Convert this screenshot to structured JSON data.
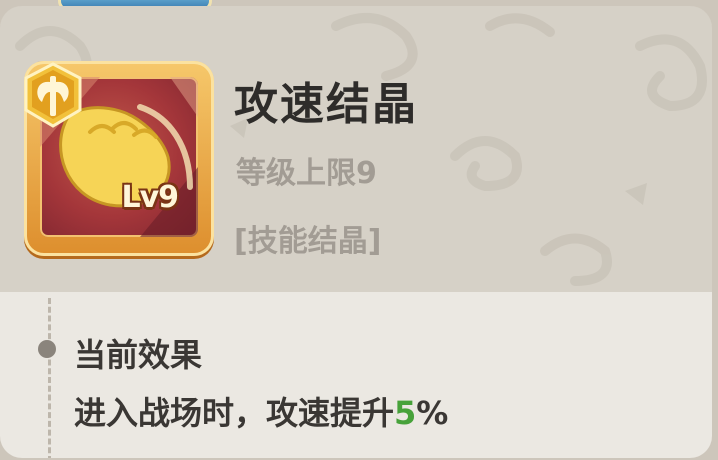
{
  "item": {
    "name": "攻速结晶",
    "level_cap_text": "等级上限9",
    "category": "[技能结晶]",
    "level_badge": "Lv9",
    "icon": "fist-crystal-icon",
    "badge_icon": "axe-emblem-icon"
  },
  "effect": {
    "header": "当前效果",
    "text_prefix": "进入战场时，攻速提升",
    "value": "5",
    "unit": "%"
  },
  "colors": {
    "highlight_value": "#47a23a",
    "title_text": "#2e2c2a",
    "muted_text": "#a29c94"
  }
}
